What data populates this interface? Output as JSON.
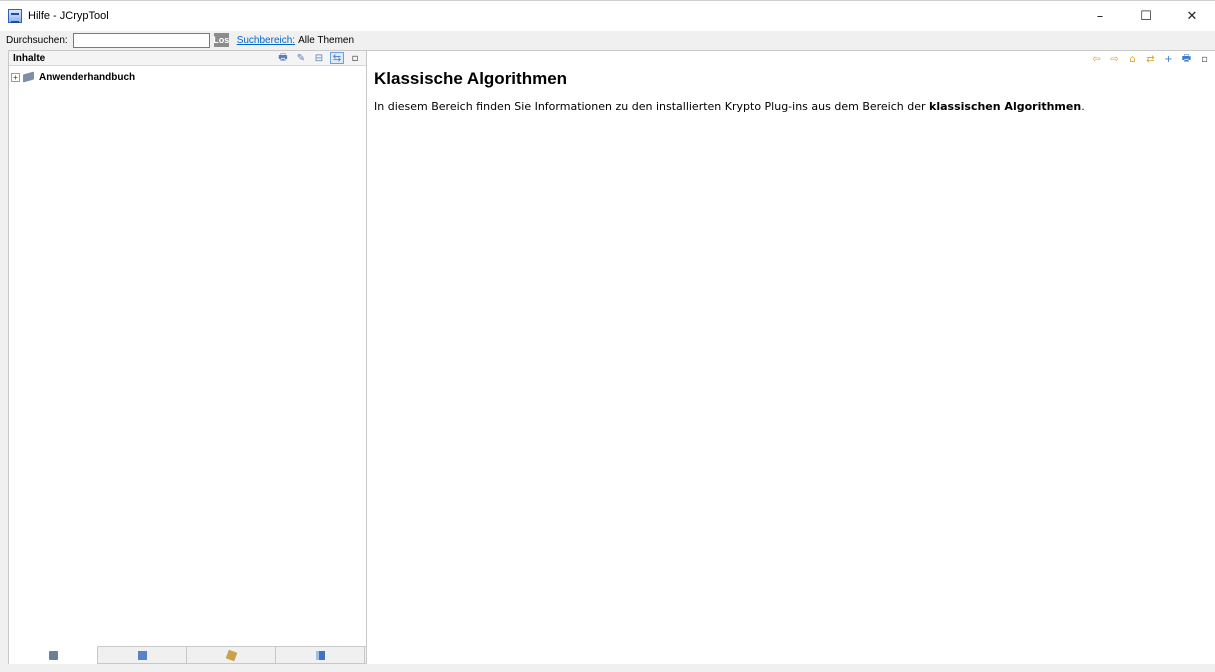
{
  "window": {
    "title": "Hilfe - JCrypTool",
    "controls": {
      "minimize": "–",
      "maximize": "☐",
      "close": "✕"
    }
  },
  "search": {
    "label": "Durchsuchen:",
    "value": "",
    "go_label": "Los",
    "scope_link": "Suchbereich:",
    "scope_value": "Alle Themen"
  },
  "left_pane": {
    "title": "Inhalte",
    "toolbar": [
      {
        "icon": "print-icon",
        "glyph": "🖶"
      },
      {
        "icon": "highlight-icon",
        "glyph": "✎"
      },
      {
        "icon": "collapse-all-icon",
        "glyph": "⊟"
      },
      {
        "icon": "link-with-contents-icon",
        "glyph": "⇆"
      },
      {
        "icon": "minimize-view-icon",
        "glyph": "▫"
      }
    ],
    "tree": [
      {
        "label": "Anwenderhandbuch",
        "expander": "+"
      }
    ],
    "bottom_tabs": [
      {
        "name": "tab-contents",
        "icon": "contents-icon",
        "active": true
      },
      {
        "name": "tab-index",
        "icon": "index-icon",
        "active": false
      },
      {
        "name": "tab-search",
        "icon": "search-icon",
        "active": false
      },
      {
        "name": "tab-bookmarks",
        "icon": "bookmarks-icon",
        "active": false
      }
    ]
  },
  "right_pane": {
    "toolbar": [
      {
        "icon": "back-icon",
        "glyph": "⇦"
      },
      {
        "icon": "forward-icon",
        "glyph": "⇨"
      },
      {
        "icon": "home-icon",
        "glyph": "⌂"
      },
      {
        "icon": "show-in-contents-icon",
        "glyph": "⇄"
      },
      {
        "icon": "bookmark-add-icon",
        "glyph": "+"
      },
      {
        "icon": "print-page-icon",
        "glyph": "🖶"
      },
      {
        "icon": "maximize-view-icon",
        "glyph": "▫"
      }
    ],
    "heading": "Klassische Algorithmen",
    "paragraph_prefix": "In diesem Bereich finden Sie Informationen zu den installierten Krypto Plug-ins aus dem Bereich der ",
    "paragraph_bold": "klassischen Algorithmen",
    "paragraph_suffix": "."
  }
}
